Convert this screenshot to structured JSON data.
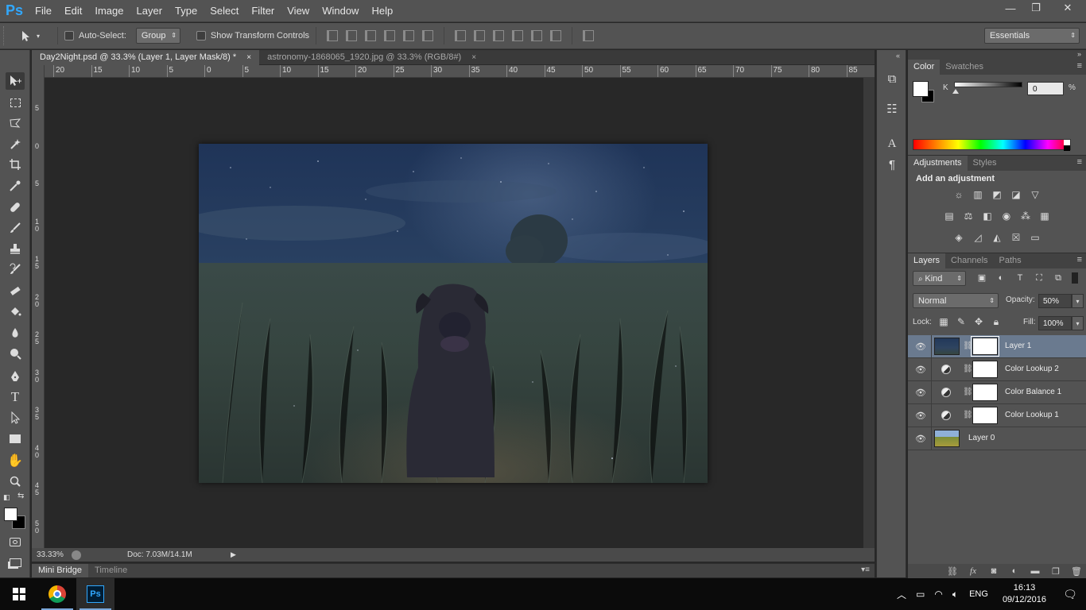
{
  "app": {
    "logo": "Ps"
  },
  "menu": [
    "File",
    "Edit",
    "Image",
    "Layer",
    "Type",
    "Select",
    "Filter",
    "View",
    "Window",
    "Help"
  ],
  "window_controls": {
    "minimize": "—",
    "restore": "❐",
    "close": "✕"
  },
  "options_bar": {
    "auto_select_label": "Auto-Select:",
    "auto_select_value": "Group",
    "show_transform_label": "Show Transform Controls",
    "workspace": "Essentials"
  },
  "tabs": [
    {
      "label": "Day2Night.psd @ 33.3% (Layer 1, Layer Mask/8) *",
      "close": "×"
    },
    {
      "label": "astronomy-1868065_1920.jpg @ 33.3% (RGB/8#)",
      "close": "×"
    }
  ],
  "ruler_top": [
    "20",
    "15",
    "10",
    "5",
    "0",
    "5",
    "10",
    "15",
    "20",
    "25",
    "30",
    "35",
    "40",
    "45",
    "50",
    "55",
    "60",
    "65",
    "70",
    "75",
    "80",
    "85"
  ],
  "ruler_left": [
    "5",
    "0",
    "5",
    "1 0",
    "1 5",
    "2 0",
    "2 5",
    "3 0",
    "3 5",
    "4 0",
    "4 5",
    "5 0"
  ],
  "status": {
    "zoom": "33.33%",
    "doc": "Doc: 7.03M/14.1M",
    "arrow": "▶"
  },
  "bottom_tabs": {
    "mini_bridge": "Mini Bridge",
    "timeline": "Timeline"
  },
  "color_panel": {
    "tab_color": "Color",
    "tab_swatches": "Swatches",
    "k_label": "K",
    "k_value": "0",
    "k_percent": "%"
  },
  "adjustments_panel": {
    "tab_adjustments": "Adjustments",
    "tab_styles": "Styles",
    "title": "Add an adjustment"
  },
  "layers_panel": {
    "tab_layers": "Layers",
    "tab_channels": "Channels",
    "tab_paths": "Paths",
    "filter_kind": "Kind",
    "blend_mode": "Normal",
    "opacity_label": "Opacity:",
    "opacity_value": "50%",
    "lock_label": "Lock:",
    "fill_label": "Fill:",
    "fill_value": "100%",
    "layers": [
      {
        "name": "Layer 1",
        "type": "image",
        "selected": true
      },
      {
        "name": "Color Lookup 2",
        "type": "adjustment",
        "selected": false
      },
      {
        "name": "Color Balance 1",
        "type": "adjustment",
        "selected": false
      },
      {
        "name": "Color Lookup 1",
        "type": "adjustment",
        "selected": false
      },
      {
        "name": "Layer 0",
        "type": "base",
        "selected": false
      }
    ]
  },
  "taskbar": {
    "language": "ENG",
    "time": "16:13",
    "date": "09/12/2016"
  },
  "colors": {
    "foreground": "#ffffff",
    "background": "#000000",
    "panel_bg": "#535353",
    "selected_layer": "#6a7a8f"
  }
}
